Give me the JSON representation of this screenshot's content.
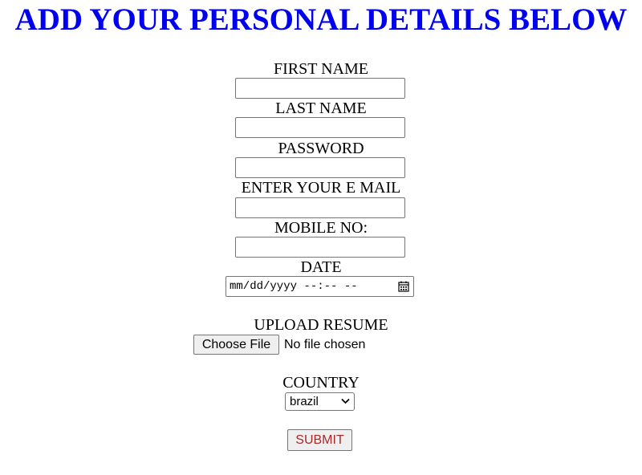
{
  "header": {
    "title": "ADD YOUR PERSONAL DETAILS BELOW",
    "title_color": "#0000ee"
  },
  "form": {
    "first_name": {
      "label": "FIRST NAME",
      "value": ""
    },
    "last_name": {
      "label": "LAST NAME",
      "value": ""
    },
    "password": {
      "label": "PASSWORD",
      "value": ""
    },
    "email": {
      "label": "ENTER YOUR E MAIL",
      "value": ""
    },
    "mobile": {
      "label": "MOBILE NO:",
      "value": ""
    },
    "date": {
      "label": "DATE",
      "placeholder_display": "mm/dd/yyyy --:-- --",
      "icon": "calendar-icon"
    },
    "resume": {
      "label": "UPLOAD RESUME",
      "button_label": "Choose File",
      "status": "No file chosen"
    },
    "country": {
      "label": "COUNTRY",
      "selected": "brazil",
      "icon": "chevron-down-icon"
    },
    "submit": {
      "label": "SUBMIT",
      "color": "#a52a2a"
    }
  }
}
